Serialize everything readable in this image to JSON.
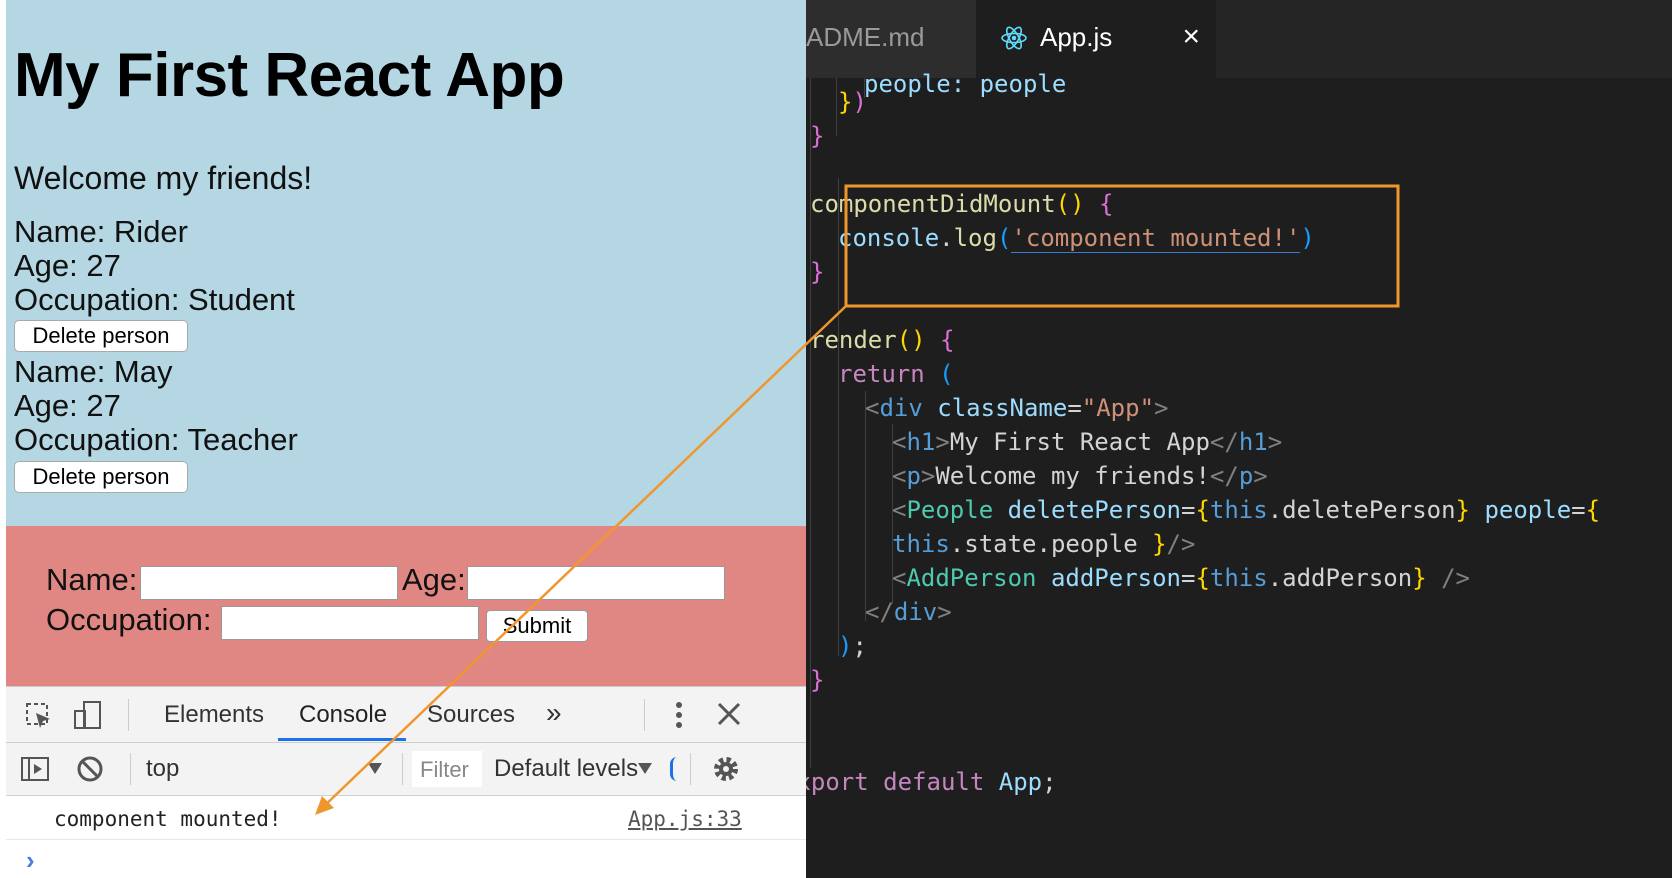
{
  "app": {
    "title": "My First React App",
    "welcome": "Welcome my friends!",
    "people": [
      {
        "name_line": "Name: Rider",
        "age_line": "Age: 27",
        "occupation_line": "Occupation: Student",
        "delete_label": "Delete person"
      },
      {
        "name_line": "Name: May",
        "age_line": "Age: 27",
        "occupation_line": "Occupation: Teacher",
        "delete_label": "Delete person"
      }
    ],
    "form": {
      "name_label": "Name:",
      "age_label": "Age:",
      "occupation_label": "Occupation:",
      "name_value": "",
      "age_value": "",
      "occupation_value": "",
      "submit_label": "Submit"
    },
    "background_color": "#b5d7e3",
    "form_color": "#e08783"
  },
  "devtools": {
    "tabs": [
      "Elements",
      "Console",
      "Sources"
    ],
    "active_tab": "Console",
    "more_label": "»",
    "context": "top",
    "filter_placeholder": "Filter",
    "levels": "Default levels",
    "log_message": "component mounted!",
    "log_source": "App.js:33",
    "prompt": "›"
  },
  "editor": {
    "tabs": [
      {
        "label": "ADME.md"
      },
      {
        "label": "App.js",
        "active": true
      }
    ],
    "code": {
      "l1": "people: people",
      "l2": "})",
      "l3": "}",
      "did_mount": "componentDidMount",
      "console": "console",
      "log": "log",
      "log_string": "'component mounted!'",
      "render": "render",
      "return_kw": "return",
      "div": "div",
      "classname_attr": "className",
      "classname_val": "\"App\"",
      "h1": "h1",
      "h1_text": "My First React App",
      "p": "p",
      "p_text": "Welcome my friends!",
      "people_comp": "People",
      "delete_attr": "deletePerson",
      "this_kw": "this",
      "delete_prop": "deletePerson",
      "people_attr": "people",
      "state_people": "state.people",
      "addperson_comp": "AddPerson",
      "addperson_attr": "addPerson",
      "addperson_prop": "addPerson",
      "export_kw": "export",
      "default_kw": "default",
      "app_name": "App"
    },
    "highlight_color": "#f0962e"
  }
}
